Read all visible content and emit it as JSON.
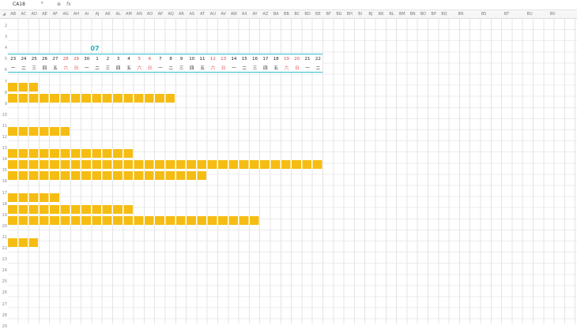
{
  "formula_bar": {
    "name_box": "CA18",
    "zoom_icon": "magnifier-icon",
    "fx_label": "fx"
  },
  "columns": [
    "AB",
    "AC",
    "AD",
    "AE",
    "AF",
    "AG",
    "AH",
    "AI",
    "AJ",
    "AK",
    "AL",
    "AM",
    "AN",
    "AO",
    "AP",
    "AQ",
    "AR",
    "AS",
    "AT",
    "AU",
    "AV",
    "AW",
    "AX",
    "AY",
    "AZ",
    "BA",
    "BB",
    "BC",
    "BD",
    "BE",
    "BF",
    "BG",
    "BH",
    "BI",
    "BJ",
    "BK",
    "BL",
    "BM",
    "BN",
    "BO",
    "BP",
    "BQ",
    "BR",
    "BS",
    "BT",
    "BU",
    "BV"
  ],
  "rows": [
    "2",
    "3",
    "4",
    "5",
    "6",
    "7",
    "8",
    "9",
    "10",
    "11",
    "12",
    "13",
    "14",
    "15",
    "16",
    "17",
    "18",
    "19",
    "20",
    "21",
    "22",
    "23",
    "24",
    "25",
    "26",
    "27",
    "28",
    "29"
  ],
  "month_label": "07",
  "dates": [
    {
      "d": "23",
      "w": "一",
      "weekend": false
    },
    {
      "d": "24",
      "w": "二",
      "weekend": false
    },
    {
      "d": "25",
      "w": "三",
      "weekend": false
    },
    {
      "d": "26",
      "w": "四",
      "weekend": false
    },
    {
      "d": "27",
      "w": "五",
      "weekend": false
    },
    {
      "d": "28",
      "w": "六",
      "weekend": true
    },
    {
      "d": "29",
      "w": "日",
      "weekend": true
    },
    {
      "d": "30",
      "w": "一",
      "weekend": false
    },
    {
      "d": "1",
      "w": "二",
      "weekend": false
    },
    {
      "d": "2",
      "w": "三",
      "weekend": false
    },
    {
      "d": "3",
      "w": "四",
      "weekend": false
    },
    {
      "d": "4",
      "w": "五",
      "weekend": false
    },
    {
      "d": "5",
      "w": "六",
      "weekend": true
    },
    {
      "d": "6",
      "w": "日",
      "weekend": true
    },
    {
      "d": "7",
      "w": "一",
      "weekend": false
    },
    {
      "d": "8",
      "w": "二",
      "weekend": false
    },
    {
      "d": "9",
      "w": "三",
      "weekend": false
    },
    {
      "d": "10",
      "w": "四",
      "weekend": false
    },
    {
      "d": "11",
      "w": "五",
      "weekend": false
    },
    {
      "d": "12",
      "w": "六",
      "weekend": true
    },
    {
      "d": "13",
      "w": "日",
      "weekend": true
    },
    {
      "d": "14",
      "w": "一",
      "weekend": false
    },
    {
      "d": "15",
      "w": "二",
      "weekend": false
    },
    {
      "d": "16",
      "w": "三",
      "weekend": false
    },
    {
      "d": "17",
      "w": "四",
      "weekend": false
    },
    {
      "d": "18",
      "w": "五",
      "weekend": false
    },
    {
      "d": "19",
      "w": "六",
      "weekend": true
    },
    {
      "d": "20",
      "w": "日",
      "weekend": true
    },
    {
      "d": "21",
      "w": "一",
      "weekend": false
    },
    {
      "d": "22",
      "w": "二",
      "weekend": false
    }
  ],
  "gantt_bars": [
    {
      "start": 0,
      "days": 3
    },
    {
      "start": 0,
      "days": 16
    },
    {
      "start": 0,
      "days": 6
    },
    {
      "start": 0,
      "days": 12
    },
    {
      "start": 0,
      "days": 30
    },
    {
      "start": 0,
      "days": 19
    },
    {
      "start": 0,
      "days": 5
    },
    {
      "start": 0,
      "days": 12
    },
    {
      "start": 0,
      "days": 24
    },
    {
      "start": 0,
      "days": 3
    }
  ],
  "colors": {
    "bar": "#f5bd13",
    "band": "#2bbfd1",
    "month": "#19b2c4",
    "weekend": "#e04848"
  }
}
